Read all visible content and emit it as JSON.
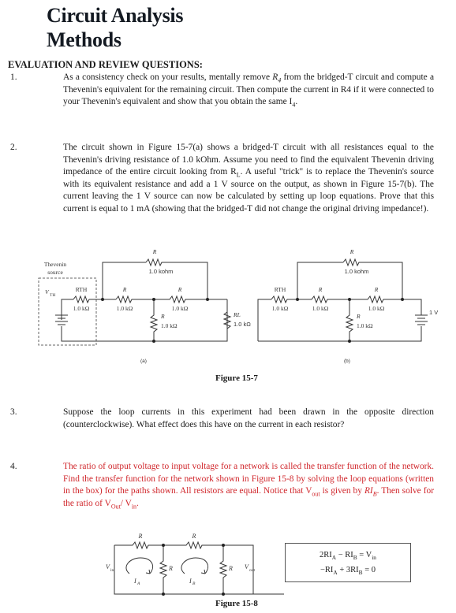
{
  "document": {
    "title_line1": "Circuit Analysis",
    "title_line2": "Methods",
    "section_heading": "EVALUATION AND REVIEW QUESTIONS:"
  },
  "questions": [
    {
      "number": "1.",
      "parts": [
        "As a consistency check on your results, mentally remove ",
        "R",
        "4",
        " from the bridged-T circuit and compute a Thevenin's equivalent for the remaining circuit. Then compute the current in R4 if it were connected to your Thevenin's equivalent and show that you obtain the same I",
        "4",
        "."
      ]
    },
    {
      "number": "2.",
      "parts": [
        "The circuit shown in Figure 15-7(a) shows a bridged-T circuit with all resistances equal to the Thevenin's driving resistance of 1.0 kOhm. Assume you need to find the equivalent Thevenin driving impedance of the entire circuit looking from R",
        "L",
        ". A useful \"trick\" is to replace the Thevenin's source with its equivalent resistance and add a 1 V source on the output, as shown in Figure 15-7(b). The current leaving the 1 V source can now be calculated by setting up loop equations. Prove that this current is equal to 1 mA (showing that the bridged-T did not change the original driving impedance!)."
      ]
    },
    {
      "number": "3.",
      "parts": [
        "Suppose the loop currents in this experiment had been drawn in the opposite direction (counterclockwise). What effect does this have on the current in each resistor?"
      ]
    },
    {
      "number": "4.",
      "parts": [
        "The ratio of output voltage to input voltage for a network is called the transfer function of the network. Find the transfer function for the network shown in Figure 15-8 by solving the loop equations (written in the box) for the paths shown. All resistors are equal. Notice that V",
        "out",
        " is given by ",
        "RI",
        "B",
        ". Then solve for the ratio of V",
        "Out",
        "/ V",
        "in",
        "."
      ],
      "color": "#d0262b"
    }
  ],
  "figure_15_7": {
    "caption": "Figure 15-7",
    "a": {
      "sublabel": "(a)",
      "thevenin_box_label_1": "Thevenin",
      "thevenin_box_label_2": "source",
      "vth_label": "V",
      "vth_sub": "TH",
      "rth_label": "RTH",
      "rth_value": "1.0 kΩ",
      "bridge_label": "R",
      "bridge_value": "1.0 kohm",
      "r1_label": "R",
      "r1_value": "1.0 kΩ",
      "r2_label": "R",
      "r2_value": "1.0 kΩ",
      "r3_label": "R",
      "r3_value": "1.0 kΩ",
      "rl_label": "RL",
      "rl_value": "1.0 kΩ"
    },
    "b": {
      "sublabel": "(b)",
      "rth_label": "RTH",
      "rth_value": "1.0 kΩ",
      "bridge_label": "R",
      "bridge_value": "1.0 kohm",
      "r1_label": "R",
      "r1_value": "1.0 kΩ",
      "r2_label": "R",
      "r2_value": "1.0 kΩ",
      "r3_label": "R",
      "r3_value": "1.0 kΩ",
      "source_label": "1 V"
    }
  },
  "figure_15_8": {
    "caption": "Figure 15-8",
    "r_label": "R",
    "vin": "V",
    "vin_sub": "in",
    "vout": "V",
    "vout_sub": "out",
    "ia": "I",
    "ia_sub": "A",
    "ib": "I",
    "ib_sub": "B",
    "equations": [
      {
        "lhs": "2RI",
        "s1": "A",
        "mid": " − RI",
        "s2": "B",
        "rhs": " = V",
        "s3": "in"
      },
      {
        "lhs": "−RI",
        "s1": "A",
        "mid": " + 3RI",
        "s2": "B",
        "rhs": " = 0",
        "s3": ""
      }
    ]
  }
}
